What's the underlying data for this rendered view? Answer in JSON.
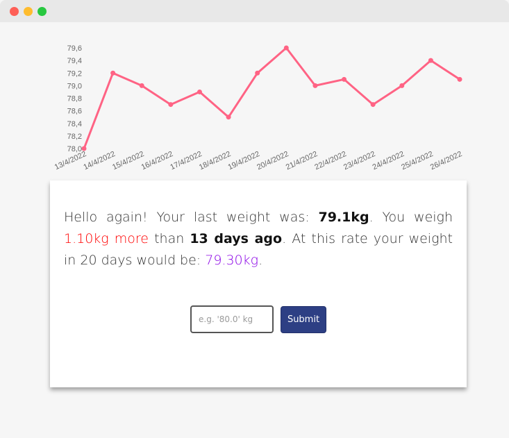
{
  "colors": {
    "line": "#ff6384",
    "more": "#ff0000",
    "projection": "#8a00e6",
    "button": "#2d3f84"
  },
  "chart_data": {
    "type": "line",
    "categories": [
      "13/4/2022",
      "14/4/2022",
      "15/4/2022",
      "16/4/2022",
      "17/4/2022",
      "18/4/2022",
      "19/4/2022",
      "20/4/2022",
      "21/4/2022",
      "22/4/2022",
      "23/4/2022",
      "24/4/2022",
      "25/4/2022",
      "26/4/2022"
    ],
    "series": [
      {
        "values": [
          78.0,
          79.2,
          79.0,
          78.7,
          78.9,
          78.5,
          79.2,
          79.6,
          79.0,
          79.1,
          78.7,
          79.0,
          79.4,
          79.1
        ]
      }
    ],
    "y_ticks": [
      "79,6",
      "79,4",
      "79,2",
      "79,0",
      "78,8",
      "78,6",
      "78,4",
      "78,2",
      "78,0"
    ],
    "ylim": [
      78.0,
      79.6
    ],
    "grid": false,
    "legend": "none"
  },
  "message": {
    "intro": "Hello again! Your last weight was: ",
    "last_weight": "79.1kg",
    "mid1": ". You weigh ",
    "diff": "1.10kg more",
    "mid2": " than ",
    "days": "13 days ago",
    "mid3": ". At this rate your weight in 20 days would be: ",
    "projection": "79.30kg",
    "end": "."
  },
  "form": {
    "input_placeholder": "e.g. '80.0' kg",
    "submit_label": "Submit"
  }
}
